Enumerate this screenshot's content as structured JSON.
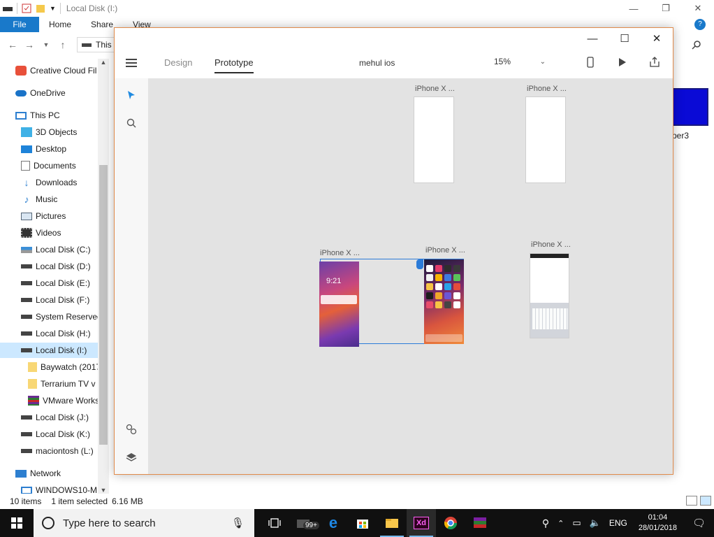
{
  "explorer": {
    "title": "Local Disk (I:)",
    "ribbon_tabs": [
      "File",
      "Home",
      "Share",
      "View"
    ],
    "address_text": "This",
    "nav_items": [
      {
        "label": "Creative Cloud Fil",
        "icon": "creative-cloud-icon"
      },
      {
        "label": "OneDrive",
        "icon": "onedrive-icon"
      },
      {
        "label": "This PC",
        "icon": "computer-icon"
      },
      {
        "label": "3D Objects",
        "icon": "3d-objects-icon"
      },
      {
        "label": "Desktop",
        "icon": "desktop-icon"
      },
      {
        "label": "Documents",
        "icon": "documents-icon"
      },
      {
        "label": "Downloads",
        "icon": "downloads-icon"
      },
      {
        "label": "Music",
        "icon": "music-icon"
      },
      {
        "label": "Pictures",
        "icon": "pictures-icon"
      },
      {
        "label": "Videos",
        "icon": "videos-icon"
      },
      {
        "label": "Local Disk (C:)",
        "icon": "drive-icon"
      },
      {
        "label": "Local Disk (D:)",
        "icon": "drive-icon"
      },
      {
        "label": "Local Disk (E:)",
        "icon": "drive-icon"
      },
      {
        "label": "Local Disk (F:)",
        "icon": "drive-icon"
      },
      {
        "label": "System Reserved",
        "icon": "drive-icon"
      },
      {
        "label": "Local Disk (H:)",
        "icon": "drive-icon"
      },
      {
        "label": "Local Disk (I:)",
        "icon": "drive-icon"
      },
      {
        "label": "Baywatch (2017",
        "icon": "folder-icon"
      },
      {
        "label": "Terrarium TV v",
        "icon": "folder-icon"
      },
      {
        "label": "VMware Works",
        "icon": "archive-icon"
      },
      {
        "label": "Local Disk (J:)",
        "icon": "drive-icon"
      },
      {
        "label": "Local Disk (K:)",
        "icon": "drive-icon"
      },
      {
        "label": "maciontosh (L:)",
        "icon": "drive-icon"
      },
      {
        "label": "Network",
        "icon": "network-icon"
      },
      {
        "label": "WINDOWS10-M",
        "icon": "computer-icon"
      }
    ],
    "file_label": "per3",
    "status": {
      "items": "10 items",
      "selected": "1 item selected",
      "size": "6.16 MB"
    }
  },
  "xd": {
    "tabs": {
      "design": "Design",
      "prototype": "Prototype"
    },
    "document_name": "mehul ios",
    "zoom": "15%",
    "artboards": [
      {
        "label": "iPhone X ..."
      },
      {
        "label": "iPhone X ..."
      },
      {
        "label": "iPhone X ..."
      },
      {
        "label": "iPhone X ..."
      },
      {
        "label": "iPhone X ..."
      }
    ],
    "lockscreen_time": "9:21"
  },
  "taskbar": {
    "search_placeholder": "Type here to search",
    "badge": "99+",
    "language": "ENG",
    "time": "01:04",
    "date": "28/01/2018"
  },
  "colors": {
    "explorer_accent": "#1979ca",
    "selection": "#cce8ff",
    "xd_border": "#e08a4a",
    "xd_wire": "#2b7bd8",
    "taskbar": "#101010"
  }
}
